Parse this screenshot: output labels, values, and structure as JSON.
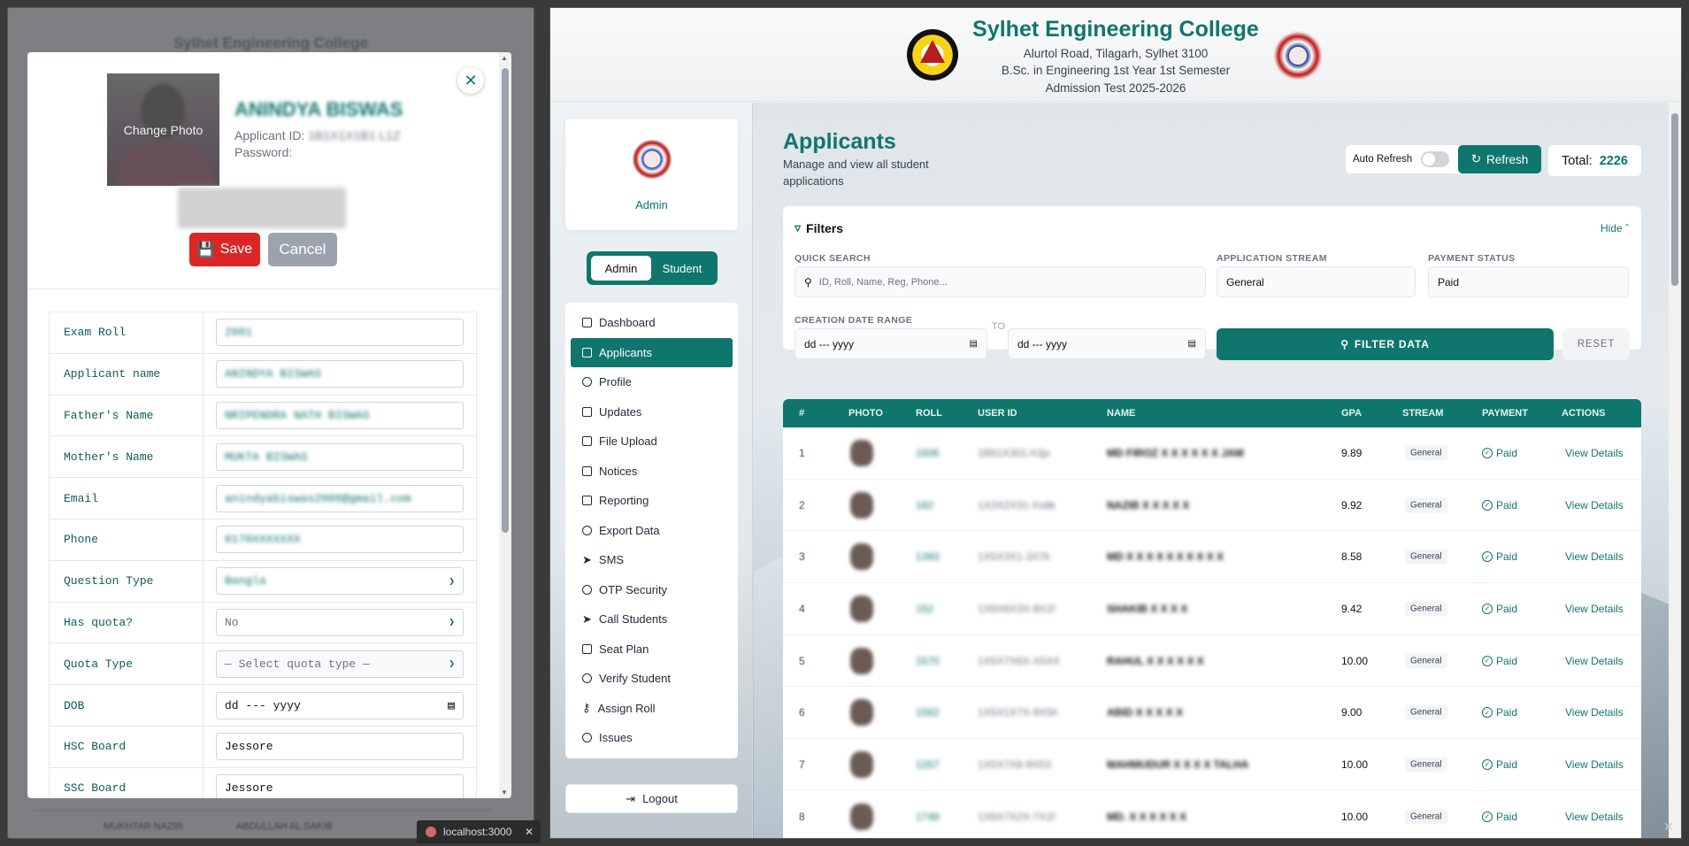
{
  "left_window": {
    "bg_title": "Sylhet Engineering College",
    "bg_bottom_label": "MUKHTAR NAZIR",
    "bg_bottom_value": "ABDULLAH AL SAKIB"
  },
  "modal": {
    "change_photo": "Change Photo",
    "applicant_name": "ANINDYA BISWAS",
    "applicant_id_label": "Applicant ID:",
    "applicant_id_value": "1B1X1X1B1 L1Z",
    "password_label": "Password:",
    "save_label": "Save",
    "cancel_label": "Cancel",
    "fields": [
      {
        "label": "Exam Roll",
        "value": "2001"
      },
      {
        "label": "Applicant name",
        "value": "ANINDYA BISWAS"
      },
      {
        "label": "Father's Name",
        "value": "NRIPENDRA NATH BISWAS"
      },
      {
        "label": "Mother's Name",
        "value": "MUKTA BISWAS"
      },
      {
        "label": "Email",
        "value": "anindyabiswas2006@gmail.com"
      },
      {
        "label": "Phone",
        "value": "0170XXXXXXX"
      },
      {
        "label": "Question Type",
        "value": "Bangla"
      },
      {
        "label": "Has quota?",
        "value": "No"
      },
      {
        "label": "Quota Type",
        "value": "— Select quota type —"
      },
      {
        "label": "DOB",
        "value": "dd --- yyyy"
      },
      {
        "label": "HSC Board",
        "value": "Jessore"
      },
      {
        "label": "SSC Board",
        "value": "Jessore"
      }
    ]
  },
  "browser_tab": {
    "label": "localhost:3000"
  },
  "header": {
    "title": "Sylhet Engineering College",
    "line1": "Alurtol Road, Tilagarh, Sylhet 3100",
    "line2": "B.Sc. in Engineering 1st Year 1st Semester",
    "line3": "Admission Test 2025-2026"
  },
  "sidebar": {
    "admin_name": "Admin",
    "toggle_admin": "Admin",
    "toggle_student": "Student",
    "items": [
      {
        "label": "Dashboard",
        "icon": "grid-icon"
      },
      {
        "label": "Applicants",
        "icon": "document-icon"
      },
      {
        "label": "Profile",
        "icon": "user-circle-icon"
      },
      {
        "label": "Updates",
        "icon": "document-icon"
      },
      {
        "label": "File Upload",
        "icon": "document-icon"
      },
      {
        "label": "Notices",
        "icon": "document-icon"
      },
      {
        "label": "Reporting",
        "icon": "document-icon"
      },
      {
        "label": "Export Data",
        "icon": "database-icon"
      },
      {
        "label": "SMS",
        "icon": "send-icon"
      },
      {
        "label": "OTP Security",
        "icon": "shield-icon"
      },
      {
        "label": "Call Students",
        "icon": "send-icon"
      },
      {
        "label": "Seat Plan",
        "icon": "calculator-icon"
      },
      {
        "label": "Verify Student",
        "icon": "shield-icon"
      },
      {
        "label": "Assign Roll",
        "icon": "key-icon"
      },
      {
        "label": "Issues",
        "icon": "help-circle-icon"
      }
    ],
    "logout": "Logout"
  },
  "main": {
    "title": "Applicants",
    "subtitle": "Manage and view all student applications",
    "auto_refresh": "Auto Refresh",
    "refresh": "Refresh",
    "total_label": "Total:",
    "total_value": "2226",
    "filters": {
      "title": "Filters",
      "hide": "Hide",
      "quick_search_label": "QUICK SEARCH",
      "quick_search_placeholder": "ID, Roll, Name, Reg, Phone...",
      "stream_label": "APPLICATION STREAM",
      "stream_value": "General",
      "payment_label": "PAYMENT STATUS",
      "payment_value": "Paid",
      "date_label": "CREATION DATE RANGE",
      "date_from": "dd --- yyyy",
      "to": "TO",
      "date_to": "dd --- yyyy",
      "filter_btn": "FILTER DATA",
      "reset_btn": "RESET"
    },
    "table": {
      "headers": [
        "#",
        "PHOTO",
        "ROLL",
        "USER ID",
        "NAME",
        "GPA",
        "STREAM",
        "PAYMENT",
        "ACTIONS"
      ],
      "rows": [
        {
          "n": "1",
          "roll": "1606",
          "uid": "1B61X301-h3js",
          "name": "MD FIROZ X X X X X X JAM",
          "gpa": "9.89",
          "stream": "General",
          "payment": "Paid",
          "action": "View Details"
        },
        {
          "n": "2",
          "roll": "182",
          "uid": "1X3X2X31-Xx8k",
          "name": "NAZIB X X X X X",
          "gpa": "9.92",
          "stream": "General",
          "payment": "Paid",
          "action": "View Details"
        },
        {
          "n": "3",
          "roll": "1393",
          "uid": "1X5X3X1-3X7k",
          "name": "MD X X X X X X X X X X",
          "gpa": "8.58",
          "stream": "General",
          "payment": "Paid",
          "action": "View Details"
        },
        {
          "n": "4",
          "roll": "152",
          "uid": "1X6X6X3X-9X1f",
          "name": "SHAKIB X X X X",
          "gpa": "9.42",
          "stream": "General",
          "payment": "Paid",
          "action": "View Details"
        },
        {
          "n": "5",
          "roll": "1570",
          "uid": "1X5X7X6X-X5X4",
          "name": "RAHUL X X X X X X",
          "gpa": "10.00",
          "stream": "General",
          "payment": "Paid",
          "action": "View Details"
        },
        {
          "n": "6",
          "roll": "1562",
          "uid": "1X5X1X7X-9X5h",
          "name": "ABID X X X X X",
          "gpa": "9.00",
          "stream": "General",
          "payment": "Paid",
          "action": "View Details"
        },
        {
          "n": "7",
          "roll": "1257",
          "uid": "1X5X7X8-9X5X",
          "name": "MAHMUDUR X X X X TALHA",
          "gpa": "10.00",
          "stream": "General",
          "payment": "Paid",
          "action": "View Details"
        },
        {
          "n": "8",
          "roll": "1748",
          "uid": "1X6X7X2X-7X1f",
          "name": "MD. X X X X X X",
          "gpa": "10.00",
          "stream": "General",
          "payment": "Paid",
          "action": "View Details"
        }
      ]
    }
  }
}
